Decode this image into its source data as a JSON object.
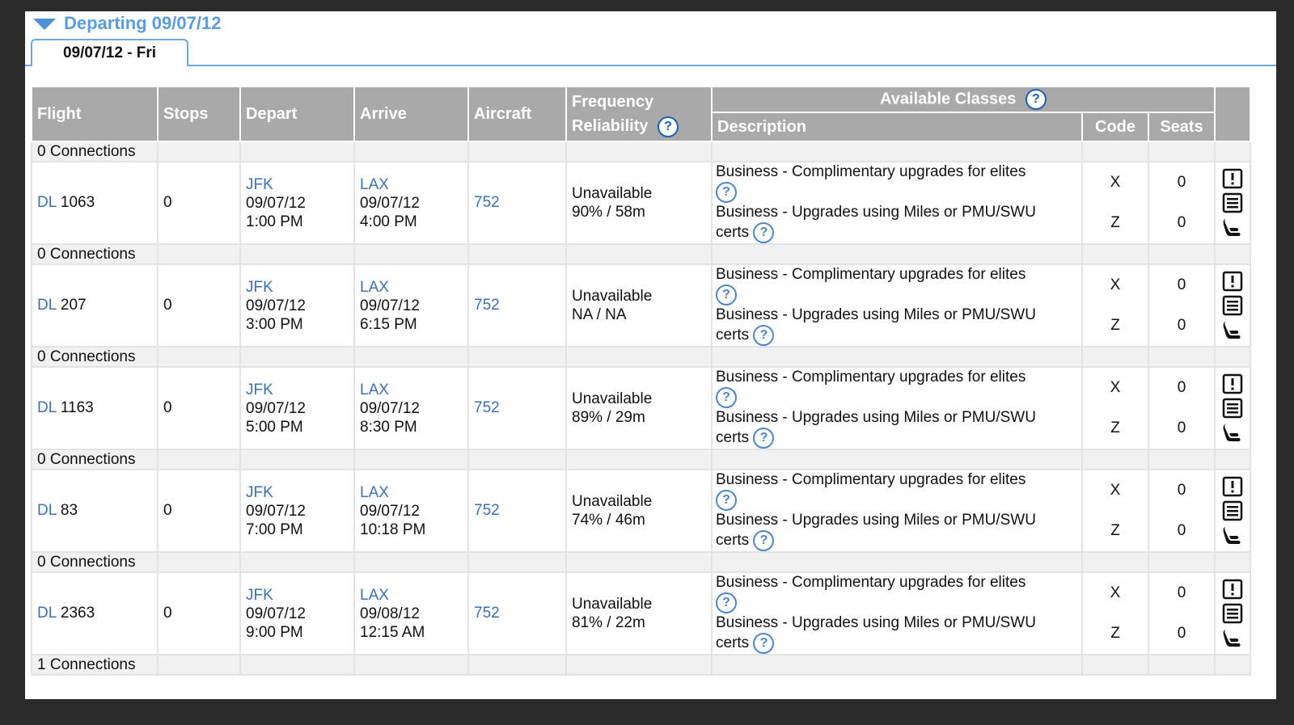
{
  "section": {
    "title": "Departing 09/07/12",
    "tab": "09/07/12 - Fri"
  },
  "headers": {
    "flight": "Flight",
    "stops": "Stops",
    "depart": "Depart",
    "arrive": "Arrive",
    "aircraft": "Aircraft",
    "frequency": "Frequency",
    "reliability": "Reliability",
    "available_classes": "Available Classes",
    "description": "Description",
    "code": "Code",
    "seats": "Seats"
  },
  "help_glyph": "?",
  "icons": [
    "alert-icon",
    "details-icon",
    "seat-icon"
  ],
  "flights": [
    {
      "connections": "0 Connections",
      "airline": "DL",
      "number": "1063",
      "stops": "0",
      "depart_airport": "JFK",
      "depart_date": "09/07/12",
      "depart_time": "1:00 PM",
      "arrive_airport": "LAX",
      "arrive_date": "09/07/12",
      "arrive_time": "4:00 PM",
      "aircraft": "752",
      "frequency": "Unavailable",
      "reliability": "90% / 58m",
      "class1_desc": "Business - Complimentary upgrades for elites",
      "class2_desc_a": "Business - Upgrades using Miles or PMU/SWU",
      "class2_desc_b": "certs",
      "code1": "X",
      "code2": "Z",
      "seats1": "0",
      "seats2": "0"
    },
    {
      "connections": "0 Connections",
      "airline": "DL",
      "number": "207",
      "stops": "0",
      "depart_airport": "JFK",
      "depart_date": "09/07/12",
      "depart_time": "3:00 PM",
      "arrive_airport": "LAX",
      "arrive_date": "09/07/12",
      "arrive_time": "6:15 PM",
      "aircraft": "752",
      "frequency": "Unavailable",
      "reliability": "NA / NA",
      "class1_desc": "Business - Complimentary upgrades for elites",
      "class2_desc_a": "Business - Upgrades using Miles or PMU/SWU",
      "class2_desc_b": "certs",
      "code1": "X",
      "code2": "Z",
      "seats1": "0",
      "seats2": "0"
    },
    {
      "connections": "0 Connections",
      "airline": "DL",
      "number": "1163",
      "stops": "0",
      "depart_airport": "JFK",
      "depart_date": "09/07/12",
      "depart_time": "5:00 PM",
      "arrive_airport": "LAX",
      "arrive_date": "09/07/12",
      "arrive_time": "8:30 PM",
      "aircraft": "752",
      "frequency": "Unavailable",
      "reliability": "89% / 29m",
      "class1_desc": "Business - Complimentary upgrades for elites",
      "class2_desc_a": "Business - Upgrades using Miles or PMU/SWU",
      "class2_desc_b": "certs",
      "code1": "X",
      "code2": "Z",
      "seats1": "0",
      "seats2": "0"
    },
    {
      "connections": "0 Connections",
      "airline": "DL",
      "number": "83",
      "stops": "0",
      "depart_airport": "JFK",
      "depart_date": "09/07/12",
      "depart_time": "7:00 PM",
      "arrive_airport": "LAX",
      "arrive_date": "09/07/12",
      "arrive_time": "10:18 PM",
      "aircraft": "752",
      "frequency": "Unavailable",
      "reliability": "74% / 46m",
      "class1_desc": "Business - Complimentary upgrades for elites",
      "class2_desc_a": "Business - Upgrades using Miles or PMU/SWU",
      "class2_desc_b": "certs",
      "code1": "X",
      "code2": "Z",
      "seats1": "0",
      "seats2": "0"
    },
    {
      "connections": "0 Connections",
      "airline": "DL",
      "number": "2363",
      "stops": "0",
      "depart_airport": "JFK",
      "depart_date": "09/07/12",
      "depart_time": "9:00 PM",
      "arrive_airport": "LAX",
      "arrive_date": "09/08/12",
      "arrive_time": "12:15 AM",
      "aircraft": "752",
      "frequency": "Unavailable",
      "reliability": "81% / 22m",
      "class1_desc": "Business - Complimentary upgrades for elites",
      "class2_desc_a": "Business - Upgrades using Miles or PMU/SWU",
      "class2_desc_b": "certs",
      "code1": "X",
      "code2": "Z",
      "seats1": "0",
      "seats2": "0"
    }
  ],
  "trailing_connections": "1 Connections"
}
